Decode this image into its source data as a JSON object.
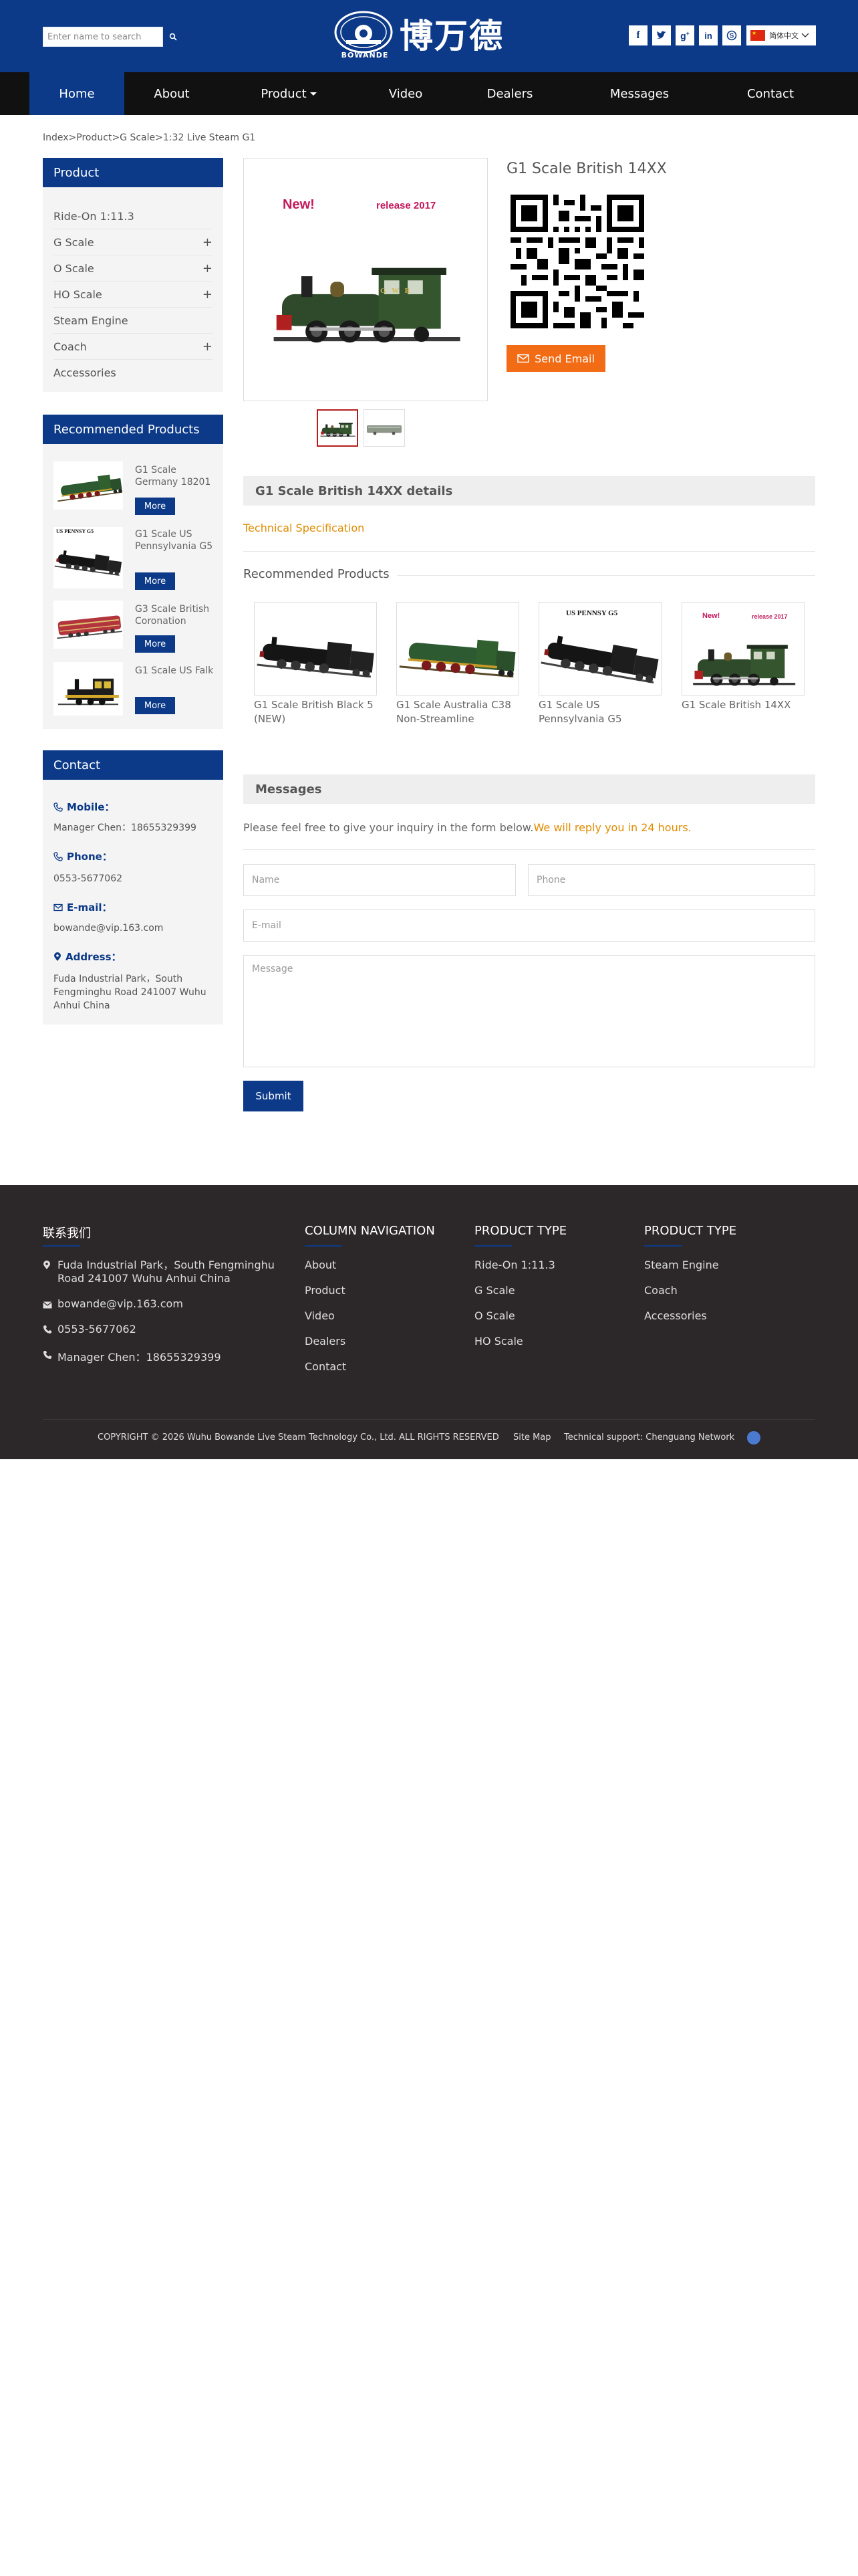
{
  "colors": {
    "brand": "#0c3a88",
    "nav_bg": "#111111",
    "accent_orange": "#f26b15",
    "highlight": "#e08b00",
    "footer_bg": "#2c2829"
  },
  "header": {
    "search_placeholder": "Enter name to search",
    "logo_text": "BOWANDE",
    "logo_cn": "博万德",
    "social_icons": [
      "facebook-icon",
      "twitter-icon",
      "google-plus-icon",
      "linkedin-icon",
      "skype-icon"
    ],
    "language_label": "简体中文"
  },
  "nav": {
    "items": [
      {
        "label": "Home",
        "active": true
      },
      {
        "label": "About"
      },
      {
        "label": "Product",
        "dropdown": true
      },
      {
        "label": "Video"
      },
      {
        "label": "Dealers"
      },
      {
        "label": "Messages"
      },
      {
        "label": "Contact"
      }
    ]
  },
  "breadcrumb": {
    "items": [
      "Index",
      "Product",
      "G Scale",
      "1:32 Live Steam G1"
    ],
    "separator": ">"
  },
  "sidebar": {
    "product_heading": "Product",
    "categories": [
      {
        "label": "Ride-On 1:11.3",
        "expandable": false
      },
      {
        "label": "G Scale",
        "expandable": true
      },
      {
        "label": "O Scale",
        "expandable": true
      },
      {
        "label": "HO Scale",
        "expandable": true
      },
      {
        "label": "Steam Engine",
        "expandable": false
      },
      {
        "label": "Coach",
        "expandable": true
      },
      {
        "label": "Accessories",
        "expandable": false
      }
    ],
    "expand_symbol": "+",
    "recommended_heading": "Recommended Products",
    "recommended": [
      {
        "title": "G1 Scale Germany 18201",
        "button": "More"
      },
      {
        "title": "G1 Scale US Pennsylvania G5",
        "button": "More",
        "image_caption": "US PENNSY G5"
      },
      {
        "title": "G3 Scale British Coronation",
        "button": "More"
      },
      {
        "title": "G1 Scale US Falk",
        "button": "More"
      }
    ],
    "contact_heading": "Contact",
    "contact": {
      "mobile_label": "Mobile：",
      "mobile_value": "Manager Chen：18655329399",
      "phone_label": "Phone：",
      "phone_value": "0553-5677062",
      "email_label": "E-mail：",
      "email_value": "bowande@vip.163.com",
      "address_label": "Address：",
      "address_value": "Fuda Industrial Park，South Fengminghu Road 241007 Wuhu Anhui China"
    }
  },
  "product": {
    "title": "G1 Scale British 14XX",
    "image_badge_new": "New!",
    "image_badge_release": "release 2017",
    "image_plate": "G W R",
    "send_email_label": "Send Email",
    "details_heading": "G1 Scale British 14XX details",
    "tech_spec_link": "Technical Specification"
  },
  "recommended_main": {
    "heading": "Recommended Products",
    "items": [
      {
        "title": "G1 Scale British Black 5 (NEW)"
      },
      {
        "title": "G1 Scale Australia C38 Non-Streamline"
      },
      {
        "title": "G1 Scale US Pennsylvania G5",
        "image_caption": "US PENNSY G5"
      },
      {
        "title": "G1 Scale British 14XX"
      }
    ]
  },
  "messages": {
    "heading": "Messages",
    "intro": "Please feel free to give your inquiry in the form below.",
    "intro_highlight": "We will reply you in 24 hours.",
    "name_placeholder": "Name",
    "phone_placeholder": "Phone",
    "email_placeholder": "E-mail",
    "message_placeholder": "Message",
    "submit_label": "Submit"
  },
  "footer": {
    "contact_heading": "联系我们",
    "address": "Fuda Industrial Park，South Fengminghu Road 241007 Wuhu Anhui China",
    "email": "bowande@vip.163.com",
    "phone": "0553-5677062",
    "mobile": "Manager Chen：18655329399",
    "column_nav_heading": "COLUMN NAVIGATION",
    "column_nav": [
      "About",
      "Product",
      "Video",
      "Dealers",
      "Contact"
    ],
    "product_type_heading_1": "PRODUCT TYPE",
    "product_type_1": [
      "Ride-On 1:11.3",
      "G Scale",
      "O Scale",
      "HO Scale"
    ],
    "product_type_heading_2": "PRODUCT TYPE",
    "product_type_2": [
      "Steam Engine",
      "Coach",
      "Accessories"
    ],
    "copyright": "COPYRIGHT © 2026 Wuhu Bowande Live Steam Technology Co., Ltd. ALL RIGHTS RESERVED",
    "sitemap": "Site Map",
    "tech_support": "Technical support: Chenguang Network"
  }
}
